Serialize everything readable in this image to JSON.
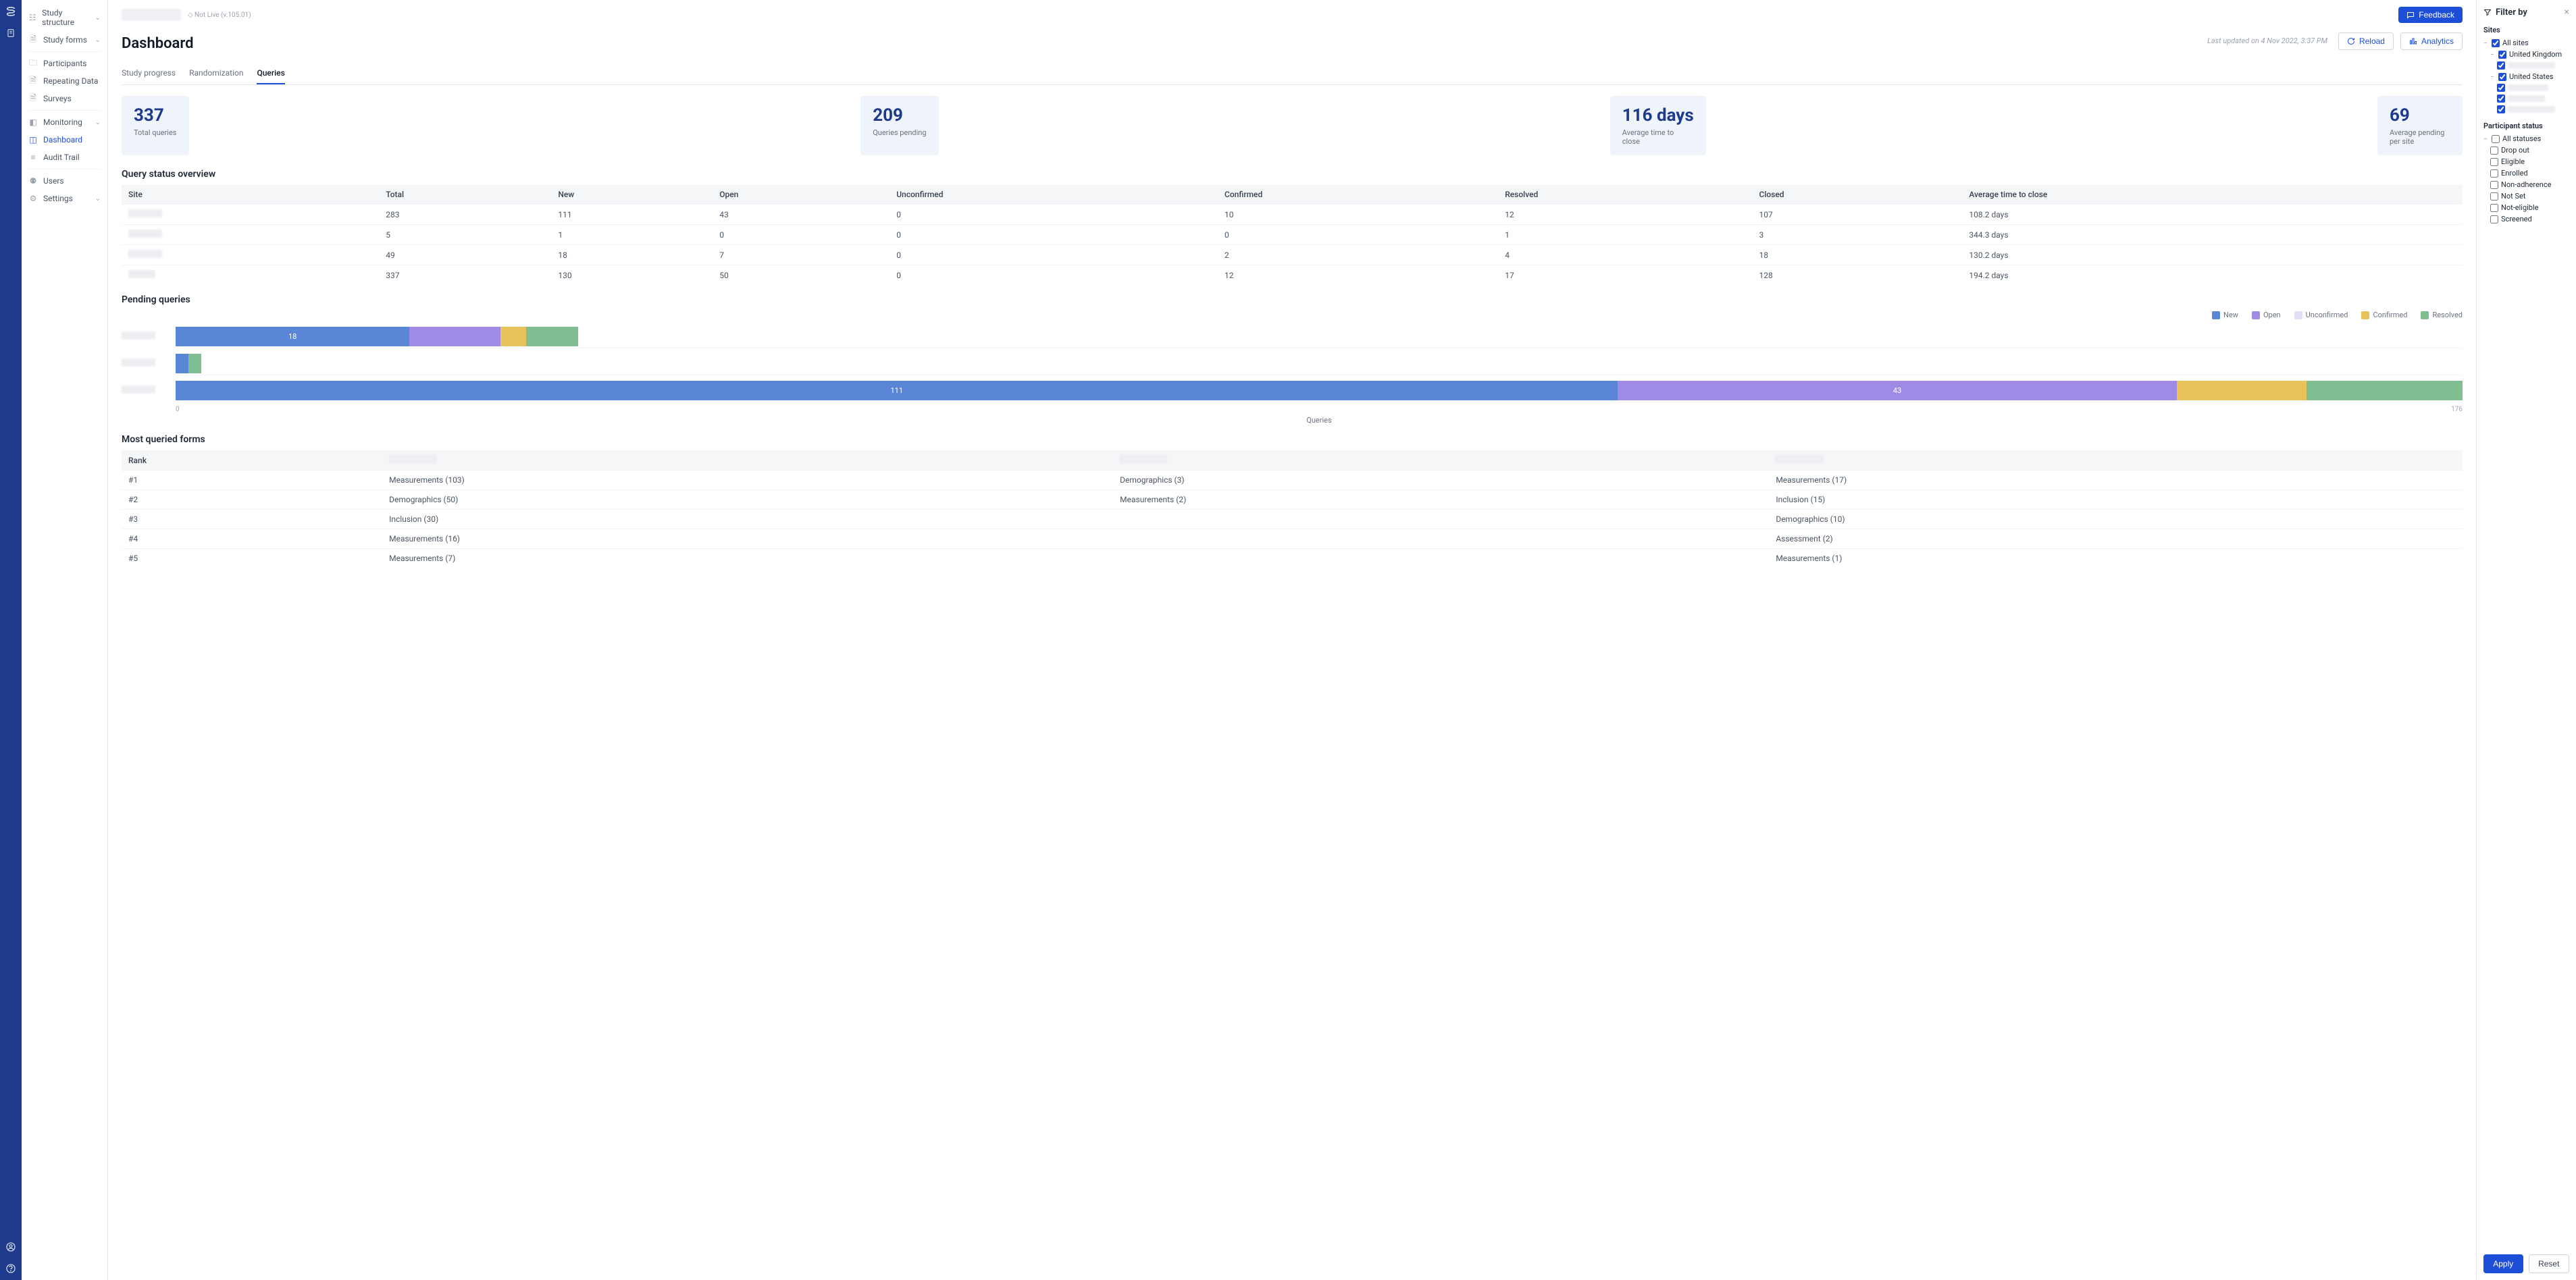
{
  "rail": {
    "icons": [
      "logo",
      "clipboard",
      "user",
      "help"
    ]
  },
  "sidebar": {
    "items": [
      {
        "label": "Study structure",
        "icon": "structure",
        "expandable": true
      },
      {
        "label": "Study forms",
        "icon": "forms",
        "expandable": true
      },
      {
        "label": "Participants",
        "icon": "folder"
      },
      {
        "label": "Repeating Data",
        "icon": "clipboard"
      },
      {
        "label": "Surveys",
        "icon": "clipboard"
      },
      {
        "label": "Monitoring",
        "icon": "monitor",
        "expandable": true
      },
      {
        "label": "Dashboard",
        "icon": "chart",
        "active": true
      },
      {
        "label": "Audit Trail",
        "icon": "list"
      },
      {
        "label": "Users",
        "icon": "users"
      },
      {
        "label": "Settings",
        "icon": "gear",
        "expandable": true
      }
    ]
  },
  "topbar": {
    "breadcrumb_redacted": true,
    "status": "◇ Not Live (v.105.01)",
    "feedback": "Feedback"
  },
  "page": {
    "title": "Dashboard",
    "last_updated": "Last updated on 4 Nov 2022, 3:37 PM",
    "reload": "Reload",
    "analytics": "Analytics",
    "tabs": [
      "Study progress",
      "Randomization",
      "Queries"
    ],
    "active_tab": 2
  },
  "cards": [
    {
      "value": "337",
      "label": "Total queries"
    },
    {
      "value": "209",
      "label": "Queries pending"
    },
    {
      "value": "116 days",
      "label": "Average time to close"
    },
    {
      "value": "69",
      "label": "Average pending per site"
    }
  ],
  "status_overview": {
    "title": "Query status overview",
    "headers": [
      "Site",
      "Total",
      "New",
      "Open",
      "Unconfirmed",
      "Confirmed",
      "Resolved",
      "Closed",
      "Average time to close"
    ],
    "rows": [
      {
        "site_redacted": true,
        "cells": [
          "283",
          "111",
          "43",
          "0",
          "10",
          "12",
          "107",
          "108.2 days"
        ]
      },
      {
        "site_redacted": true,
        "cells": [
          "5",
          "1",
          "0",
          "0",
          "0",
          "1",
          "3",
          "344.3 days"
        ]
      },
      {
        "site_redacted": true,
        "cells": [
          "49",
          "18",
          "7",
          "0",
          "2",
          "4",
          "18",
          "130.2 days"
        ]
      },
      {
        "site_redacted": true,
        "total_row": true,
        "cells": [
          "337",
          "130",
          "50",
          "0",
          "12",
          "17",
          "128",
          "194.2 days"
        ]
      }
    ]
  },
  "pending_chart": {
    "title": "Pending queries",
    "legend": [
      {
        "label": "New",
        "color": "#5a86d8"
      },
      {
        "label": "Open",
        "color": "#9f8ae6"
      },
      {
        "label": "Unconfirmed",
        "color": "#e3ddf7"
      },
      {
        "label": "Confirmed",
        "color": "#e8c35b"
      },
      {
        "label": "Resolved",
        "color": "#7fbf91"
      }
    ],
    "axis_label": "Queries",
    "x_min": 0,
    "x_max": 176
  },
  "chart_data": {
    "type": "bar",
    "orientation": "horizontal-stacked",
    "x_label": "Queries",
    "x_range": [
      0,
      176
    ],
    "series_names": [
      "New",
      "Open",
      "Unconfirmed",
      "Confirmed",
      "Resolved"
    ],
    "colors": [
      "#5a86d8",
      "#9f8ae6",
      "#e3ddf7",
      "#e8c35b",
      "#7fbf91"
    ],
    "categories": [
      "(redacted site 1)",
      "(redacted site 2)",
      "(redacted site 3)"
    ],
    "values": [
      [
        18,
        7,
        0,
        2,
        4
      ],
      [
        1,
        0,
        0,
        0,
        1
      ],
      [
        111,
        43,
        0,
        10,
        12
      ]
    ],
    "visible_labels": [
      [
        "18",
        "",
        "",
        "",
        ""
      ],
      [
        "",
        "",
        "",
        "",
        ""
      ],
      [
        "111",
        "43",
        "",
        "",
        ""
      ]
    ]
  },
  "most_queried": {
    "title": "Most queried forms",
    "headers": [
      "Rank",
      "",
      "",
      ""
    ],
    "col_redacted": [
      false,
      true,
      true,
      true
    ],
    "rows": [
      {
        "rank": "#1",
        "c1": "Measurements (103)",
        "c2": "Demographics (3)",
        "c3": "Measurements (17)"
      },
      {
        "rank": "#2",
        "c1": "Demographics (50)",
        "c2": "Measurements (2)",
        "c3": "Inclusion (15)"
      },
      {
        "rank": "#3",
        "c1": "Inclusion (30)",
        "c2": "",
        "c3": "Demographics (10)"
      },
      {
        "rank": "#4",
        "c1": "Measurements (16)",
        "c2": "",
        "c3": "Assessment (2)"
      },
      {
        "rank": "#5",
        "c1": "Measurements (7)",
        "c2": "",
        "c3": "Measurements (1)"
      }
    ]
  },
  "filters": {
    "title": "Filter by",
    "sites_label": "Sites",
    "all_sites": "All sites",
    "countries": [
      {
        "name": "United Kingdom",
        "children_redacted": 1
      },
      {
        "name": "United States",
        "children_redacted": 3
      }
    ],
    "participant_status_label": "Participant status",
    "all_statuses": "All statuses",
    "statuses": [
      "Drop out",
      "Eligible",
      "Enrolled",
      "Non-adherence",
      "Not Set",
      "Not-eligible",
      "Screened"
    ],
    "apply": "Apply",
    "reset": "Reset"
  }
}
